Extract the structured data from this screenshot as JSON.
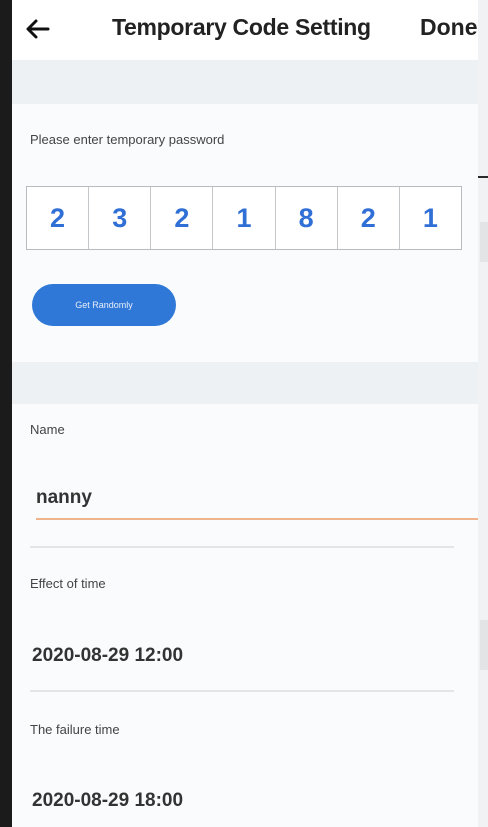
{
  "header": {
    "title": "Temporary Code Setting",
    "done_label": "Done",
    "back_icon": "arrow-left-icon"
  },
  "code": {
    "prompt": "Please enter temporary password",
    "digits": [
      "2",
      "3",
      "2",
      "1",
      "8",
      "2",
      "1"
    ],
    "random_button_label": "Get Randomly"
  },
  "name": {
    "label": "Name",
    "value": "nanny"
  },
  "effect_time": {
    "label": "Effect of time",
    "value": "2020-08-29 12:00"
  },
  "failure_time": {
    "label": "The failure time",
    "value": "2020-08-29 18:00"
  },
  "colors": {
    "accent": "#2f78d8",
    "digit": "#2f6fd6",
    "input_underline": "#f0b48a"
  }
}
